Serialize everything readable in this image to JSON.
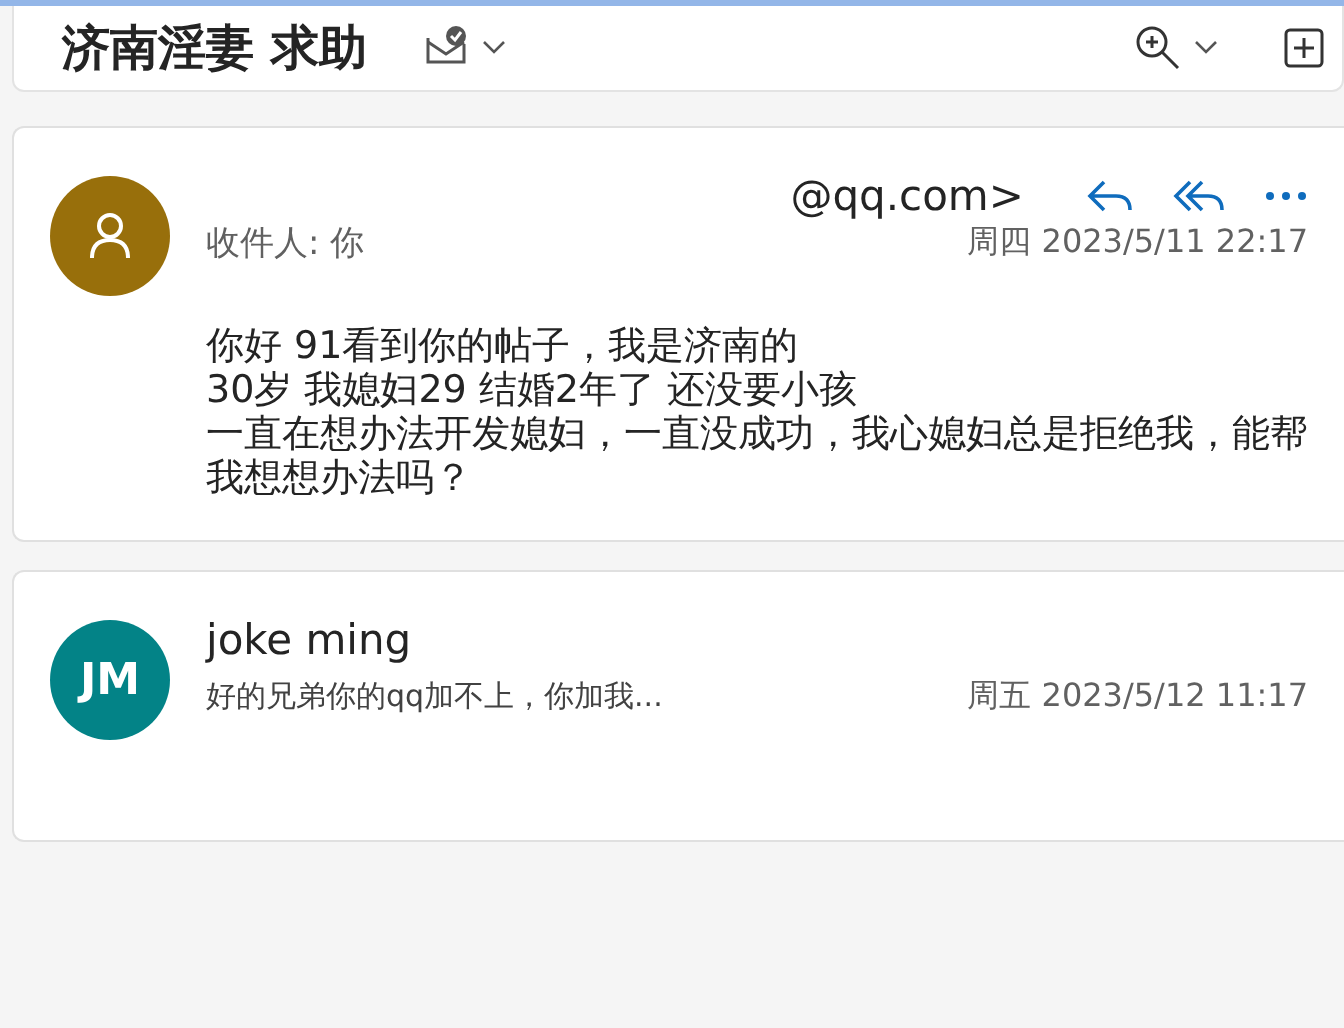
{
  "title": "济南淫妻 求助",
  "messages": [
    {
      "kind": "open",
      "avatar": {
        "kind": "icon",
        "color": "#986f0b"
      },
      "sender": "@qq.com>",
      "recipient": "收件人: 你",
      "date": "周四 2023/5/11 22:17",
      "body": [
        "你好 91看到你的帖子，我是济南的",
        "30岁  我媳妇29  结婚2年了   还没要小孩",
        "一直在想办法开发媳妇，一直没成功，我心媳妇总是拒绝我，能帮我想想办法吗？"
      ]
    },
    {
      "kind": "collapsed",
      "avatar": {
        "kind": "initials",
        "initials": "JM",
        "color": "#038387"
      },
      "sender": "joke ming",
      "preview": "好的兄弟你的qq加不上，你加我...",
      "date": "周五 2023/5/12 11:17"
    }
  ]
}
